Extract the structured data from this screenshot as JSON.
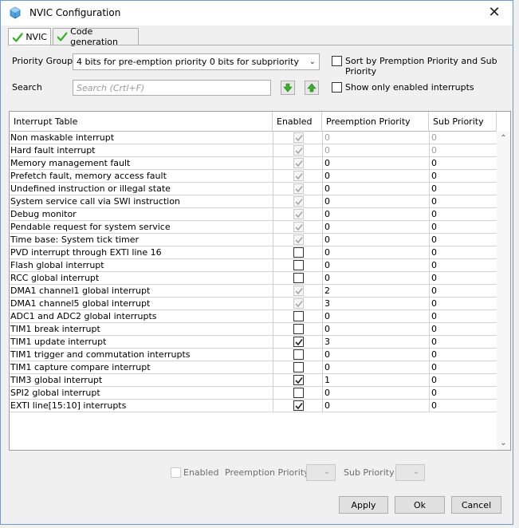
{
  "window": {
    "title": "NVIC Configuration",
    "close_glyph": "✕"
  },
  "tabs": [
    {
      "label": "NVIC",
      "icon": "green-check-icon",
      "active": true
    },
    {
      "label": "Code generation",
      "icon": "green-check-icon",
      "active": false
    }
  ],
  "priority_group": {
    "label": "Priority Group",
    "value": "4 bits for pre-emption priority 0 bits for subpriority"
  },
  "sort_option": {
    "label": "Sort by Premption Priority and Sub Priority",
    "checked": false
  },
  "search": {
    "label": "Search",
    "placeholder": "Search (Crtl+F)"
  },
  "show_enabled": {
    "label": "Show only enabled interrupts",
    "checked": false
  },
  "table": {
    "columns": [
      "Interrupt Table",
      "Enabled",
      "Preemption Priority",
      "Sub Priority"
    ],
    "rows": [
      {
        "name": "Non maskable interrupt",
        "enabled": true,
        "locked": true,
        "preemption": "0",
        "sub": "0",
        "dim": true
      },
      {
        "name": "Hard fault interrupt",
        "enabled": true,
        "locked": true,
        "preemption": "0",
        "sub": "0",
        "dim": true
      },
      {
        "name": "Memory management fault",
        "enabled": true,
        "locked": true,
        "preemption": "0",
        "sub": "0",
        "dim": false
      },
      {
        "name": "Prefetch fault, memory access fault",
        "enabled": true,
        "locked": true,
        "preemption": "0",
        "sub": "0",
        "dim": false
      },
      {
        "name": "Undefined instruction or illegal state",
        "enabled": true,
        "locked": true,
        "preemption": "0",
        "sub": "0",
        "dim": false
      },
      {
        "name": "System service call via SWI instruction",
        "enabled": true,
        "locked": true,
        "preemption": "0",
        "sub": "0",
        "dim": false
      },
      {
        "name": "Debug monitor",
        "enabled": true,
        "locked": true,
        "preemption": "0",
        "sub": "0",
        "dim": false
      },
      {
        "name": "Pendable request for system service",
        "enabled": true,
        "locked": true,
        "preemption": "0",
        "sub": "0",
        "dim": false
      },
      {
        "name": "Time base: System tick timer",
        "enabled": true,
        "locked": true,
        "preemption": "0",
        "sub": "0",
        "dim": false
      },
      {
        "name": "PVD interrupt through EXTI line 16",
        "enabled": false,
        "locked": false,
        "preemption": "0",
        "sub": "0",
        "dim": false
      },
      {
        "name": "Flash global interrupt",
        "enabled": false,
        "locked": false,
        "preemption": "0",
        "sub": "0",
        "dim": false
      },
      {
        "name": "RCC global interrupt",
        "enabled": false,
        "locked": false,
        "preemption": "0",
        "sub": "0",
        "dim": false
      },
      {
        "name": "DMA1 channel1 global interrupt",
        "enabled": true,
        "locked": true,
        "preemption": "2",
        "sub": "0",
        "dim": false
      },
      {
        "name": "DMA1 channel5 global interrupt",
        "enabled": true,
        "locked": true,
        "preemption": "3",
        "sub": "0",
        "dim": false
      },
      {
        "name": "ADC1 and ADC2 global interrupts",
        "enabled": false,
        "locked": false,
        "preemption": "0",
        "sub": "0",
        "dim": false
      },
      {
        "name": "TIM1 break interrupt",
        "enabled": false,
        "locked": false,
        "preemption": "0",
        "sub": "0",
        "dim": false
      },
      {
        "name": "TIM1 update interrupt",
        "enabled": true,
        "locked": false,
        "preemption": "3",
        "sub": "0",
        "dim": false
      },
      {
        "name": "TIM1 trigger and commutation interrupts",
        "enabled": false,
        "locked": false,
        "preemption": "0",
        "sub": "0",
        "dim": false
      },
      {
        "name": "TIM1 capture compare interrupt",
        "enabled": false,
        "locked": false,
        "preemption": "0",
        "sub": "0",
        "dim": false
      },
      {
        "name": "TIM3 global interrupt",
        "enabled": true,
        "locked": false,
        "preemption": "1",
        "sub": "0",
        "dim": false
      },
      {
        "name": "SPI2 global interrupt",
        "enabled": false,
        "locked": false,
        "preemption": "0",
        "sub": "0",
        "dim": false
      },
      {
        "name": "EXTI line[15:10] interrupts",
        "enabled": true,
        "locked": false,
        "preemption": "0",
        "sub": "0",
        "dim": false
      }
    ]
  },
  "bottom_controls": {
    "enabled_label": "Enabled",
    "preemption_label": "Preemption Priority",
    "sub_label": "Sub Priority"
  },
  "buttons": {
    "apply": "Apply",
    "ok": "Ok",
    "cancel": "Cancel"
  },
  "colors": {
    "accent_green": "#3dae2b",
    "window_border": "#6b9bd2"
  }
}
